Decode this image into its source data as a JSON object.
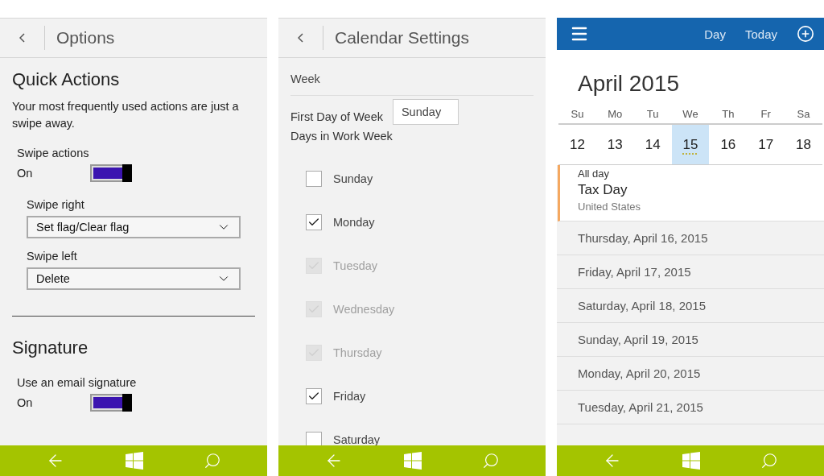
{
  "options_screen": {
    "title": "Options",
    "sections": [
      {
        "heading": "Quick Actions",
        "description": "Your most frequently used actions are just a swipe away.",
        "toggle": {
          "label": "Swipe actions",
          "state_text": "On",
          "on": true
        },
        "dropdowns": [
          {
            "label": "Swipe right",
            "value": "Set flag/Clear flag"
          },
          {
            "label": "Swipe left",
            "value": "Delete"
          }
        ]
      },
      {
        "heading": "Signature",
        "toggle": {
          "label": "Use an email signature",
          "state_text": "On",
          "on": true
        }
      }
    ]
  },
  "calendar_settings_screen": {
    "title": "Calendar Settings",
    "group": "Week",
    "first_day_label": "First Day of Week",
    "first_day_value": "Sunday",
    "work_week_label": "Days in Work Week",
    "days": [
      {
        "label": "Sunday",
        "checked": false,
        "disabled": false
      },
      {
        "label": "Monday",
        "checked": true,
        "disabled": false
      },
      {
        "label": "Tuesday",
        "checked": true,
        "disabled": true
      },
      {
        "label": "Wednesday",
        "checked": true,
        "disabled": true
      },
      {
        "label": "Thursday",
        "checked": true,
        "disabled": true
      },
      {
        "label": "Friday",
        "checked": true,
        "disabled": false
      },
      {
        "label": "Saturday",
        "checked": false,
        "disabled": false
      }
    ]
  },
  "calendar_screen": {
    "header_buttons": [
      "Day",
      "Today"
    ],
    "month": "April 2015",
    "week": [
      {
        "weekday": "Su",
        "date": "12",
        "selected": false
      },
      {
        "weekday": "Mo",
        "date": "13",
        "selected": false
      },
      {
        "weekday": "Tu",
        "date": "14",
        "selected": false
      },
      {
        "weekday": "We",
        "date": "15",
        "selected": true
      },
      {
        "weekday": "Th",
        "date": "16",
        "selected": false
      },
      {
        "weekday": "Fr",
        "date": "17",
        "selected": false
      },
      {
        "weekday": "Sa",
        "date": "18",
        "selected": false
      }
    ],
    "event": {
      "time": "All day",
      "title": "Tax Day",
      "subtitle": "United States"
    },
    "day_rows": [
      "Thursday, April 16, 2015",
      "Friday, April 17, 2015",
      "Saturday, April 18, 2015",
      "Sunday, April 19, 2015",
      "Monday, April 20, 2015",
      "Tuesday, April 21, 2015"
    ]
  }
}
